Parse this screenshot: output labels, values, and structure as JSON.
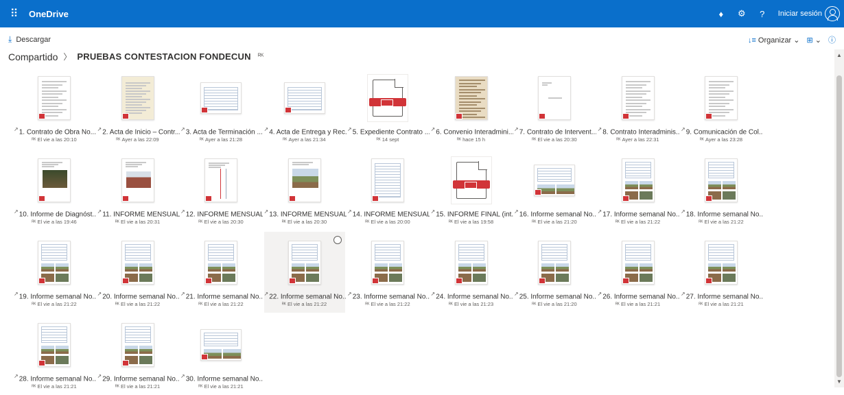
{
  "app": {
    "title": "OneDrive",
    "signin": "Iniciar sesión"
  },
  "icons": {
    "waffle": "waffle-icon",
    "premium": "diamond-icon",
    "settings": "gear-icon",
    "help": "help-icon",
    "avatar": "person-icon"
  },
  "colors": {
    "brand": "#0a6fcb",
    "pdf": "#d13438"
  },
  "commandbar": {
    "download": "Descargar",
    "organize": "Organizar",
    "view": "⊞",
    "info": "ⓘ"
  },
  "breadcrumb": {
    "root": "Compartido",
    "current": "PRUEBAS CONTESTACION FONDECUN"
  },
  "files": [
    {
      "name": "1. Contrato de Obra No...",
      "meta": "El vie a las 20:10",
      "thumb": "text"
    },
    {
      "name": "2. Acta de Inicio – Contr...",
      "meta": "Ayer a las 22:09",
      "thumb": "yellow"
    },
    {
      "name": "3. Acta de Terminación ...",
      "meta": "Ayer a las 21:28",
      "thumb": "table-wide"
    },
    {
      "name": "4. Acta de Entrega y Rec...",
      "meta": "Ayer a las 21:34",
      "thumb": "table-wide"
    },
    {
      "name": "5. Expediente Contrato ...",
      "meta": "14 sept",
      "thumb": "generic"
    },
    {
      "name": "6. Convenio Interadmini...",
      "meta": "hace 15 h",
      "thumb": "sepia"
    },
    {
      "name": "7. Contrato de Intervent...",
      "meta": "El vie a las 20:30",
      "thumb": "blank"
    },
    {
      "name": "8. Contrato Interadminis...",
      "meta": "Ayer a las 22:31",
      "thumb": "text"
    },
    {
      "name": "9. Comunicación de Col...",
      "meta": "Ayer a las 23:28",
      "thumb": "text"
    },
    {
      "name": "10. Informe de Diagnóst...",
      "meta": "El vie a las 19:46",
      "thumb": "photo-dark"
    },
    {
      "name": "11. INFORME MENSUAL...",
      "meta": "El vie a las 20:31",
      "thumb": "photo-red"
    },
    {
      "name": "12. INFORME MENSUAL...",
      "meta": "El vie a las 20:30",
      "thumb": "chart"
    },
    {
      "name": "13. INFORME MENSUAL...",
      "meta": "El vie a las 20:30",
      "thumb": "photo-sky"
    },
    {
      "name": "14. INFORME MENSUAL...",
      "meta": "El vie a las 20:00",
      "thumb": "table"
    },
    {
      "name": "15. INFORME FINAL (int...",
      "meta": "El vie a las 19:58",
      "thumb": "generic"
    },
    {
      "name": "16. Informe semanal No...",
      "meta": "El vie a las 21:20",
      "thumb": "weekly-wide"
    },
    {
      "name": "17. Informe semanal No...",
      "meta": "El vie a las 21:22",
      "thumb": "weekly"
    },
    {
      "name": "18. Informe semanal No...",
      "meta": "El vie a las 21:22",
      "thumb": "weekly"
    },
    {
      "name": "19. Informe semanal No...",
      "meta": "El vie a las 21:22",
      "thumb": "weekly"
    },
    {
      "name": "20. Informe semanal No...",
      "meta": "El vie a las 21:22",
      "thumb": "weekly"
    },
    {
      "name": "21. Informe semanal No...",
      "meta": "El vie a las 21:22",
      "thumb": "weekly"
    },
    {
      "name": "22. Informe semanal No...",
      "meta": "El vie a las 21:22",
      "thumb": "weekly",
      "selected": true
    },
    {
      "name": "23. Informe semanal No...",
      "meta": "El vie a las 21:22",
      "thumb": "weekly"
    },
    {
      "name": "24. Informe semanal No...",
      "meta": "El vie a las 21:23",
      "thumb": "weekly"
    },
    {
      "name": "25. Informe semanal No...",
      "meta": "El vie a las 21:20",
      "thumb": "weekly"
    },
    {
      "name": "26. Informe semanal No...",
      "meta": "El vie a las 21:21",
      "thumb": "weekly"
    },
    {
      "name": "27. Informe semanal No...",
      "meta": "El vie a las 21:21",
      "thumb": "weekly"
    },
    {
      "name": "28. Informe semanal No...",
      "meta": "El vie a las 21:21",
      "thumb": "weekly"
    },
    {
      "name": "29. Informe semanal No...",
      "meta": "El vie a las 21:21",
      "thumb": "weekly"
    },
    {
      "name": "30. Informe semanal No...",
      "meta": "El vie a las 21:21",
      "thumb": "weekly-wide"
    }
  ]
}
